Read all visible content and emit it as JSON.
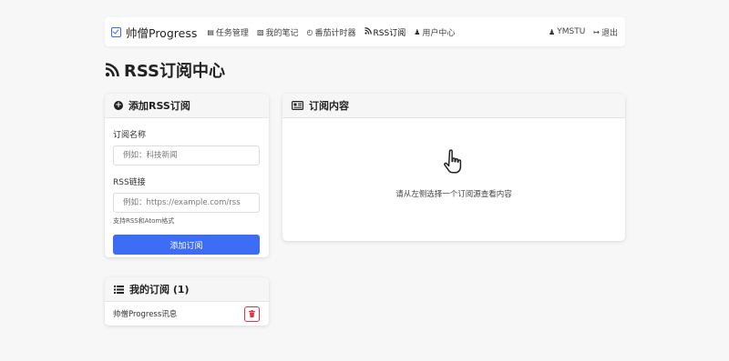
{
  "navbar": {
    "brand": "帅僧Progress",
    "links": [
      {
        "icon": "tasks-icon",
        "label": "任务管理"
      },
      {
        "icon": "notes-icon",
        "label": "我的笔记"
      },
      {
        "icon": "timer-icon",
        "label": "番茄计时器"
      },
      {
        "icon": "rss-icon",
        "label": "RSS订阅"
      },
      {
        "icon": "user-icon",
        "label": "用户中心"
      }
    ],
    "user": "YMSTU",
    "logout": "退出"
  },
  "page": {
    "title": "RSS订阅中心"
  },
  "add_form": {
    "title": "添加RSS订阅",
    "name_label": "订阅名称",
    "name_placeholder": "例如：科技新闻",
    "url_label": "RSS链接",
    "url_placeholder": "例如：https://example.com/rss",
    "help": "支持RSS和Atom格式",
    "submit": "添加订阅"
  },
  "content": {
    "title": "订阅内容",
    "empty_text": "请从左侧选择一个订阅源查看内容"
  },
  "subscriptions": {
    "title": "我的订阅 (1)",
    "items": [
      {
        "name": "帅僧Progress讯息"
      }
    ]
  },
  "colors": {
    "accent": "#3d6df5",
    "danger": "#dc3545"
  }
}
